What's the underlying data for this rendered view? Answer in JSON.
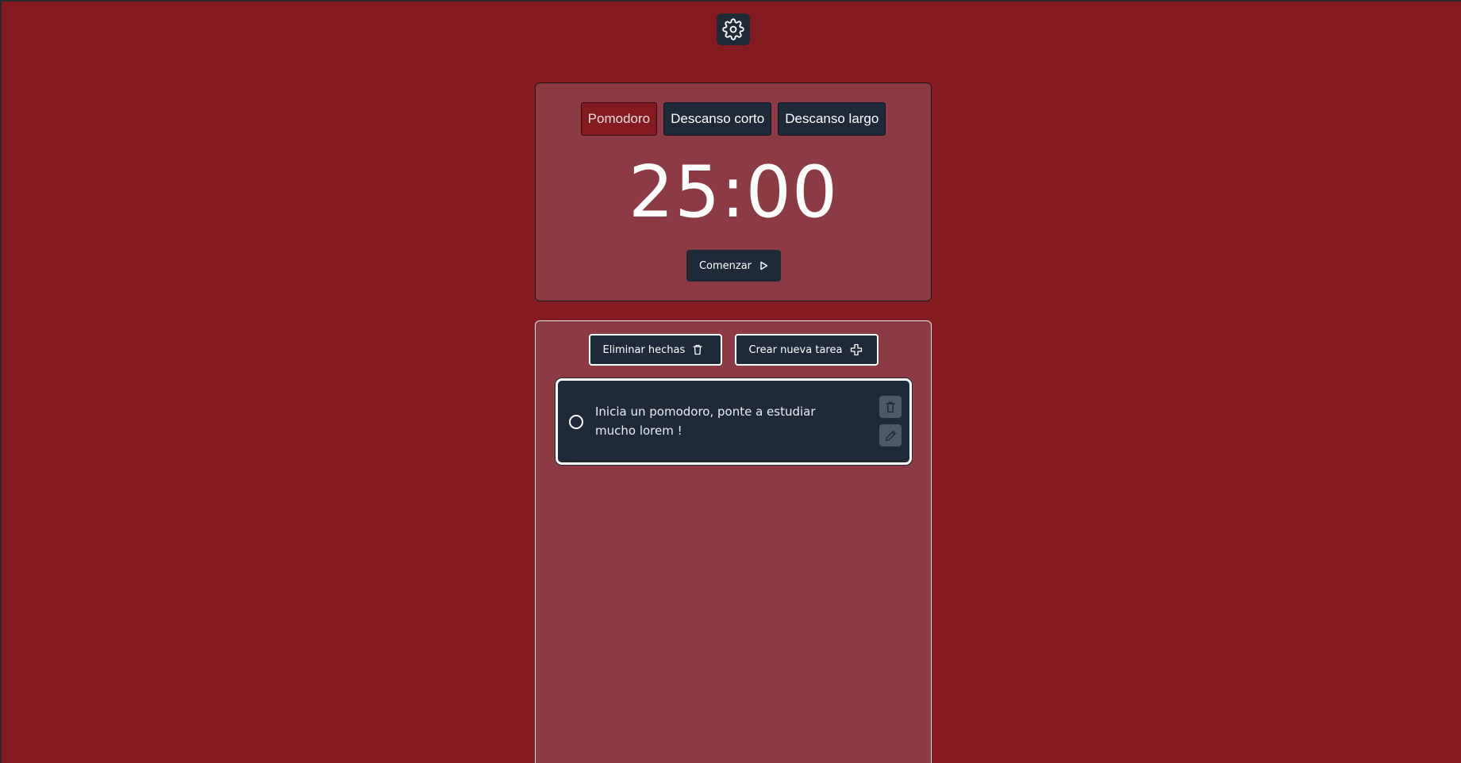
{
  "header": {
    "settings_icon": "gear-icon"
  },
  "timer": {
    "modes": [
      {
        "label": "Pomodoro",
        "active": true
      },
      {
        "label": "Descanso corto",
        "active": false
      },
      {
        "label": "Descanso largo",
        "active": false
      }
    ],
    "display": "25:00",
    "start_label": "Comenzar",
    "start_icon": "play-icon"
  },
  "tasks": {
    "delete_done_label": "Eliminar hechas",
    "delete_done_icon": "trash-icon",
    "new_task_label": "Crear nueva tarea",
    "new_task_icon": "plus-icon",
    "items": [
      {
        "text": "Inicia un pomodoro, ponte a estudiar mucho lorem !",
        "done": false
      }
    ]
  },
  "colors": {
    "background": "#841b20",
    "card": "#8c3a43",
    "dark": "#1e2a38",
    "icon_button": "#4e5966"
  }
}
